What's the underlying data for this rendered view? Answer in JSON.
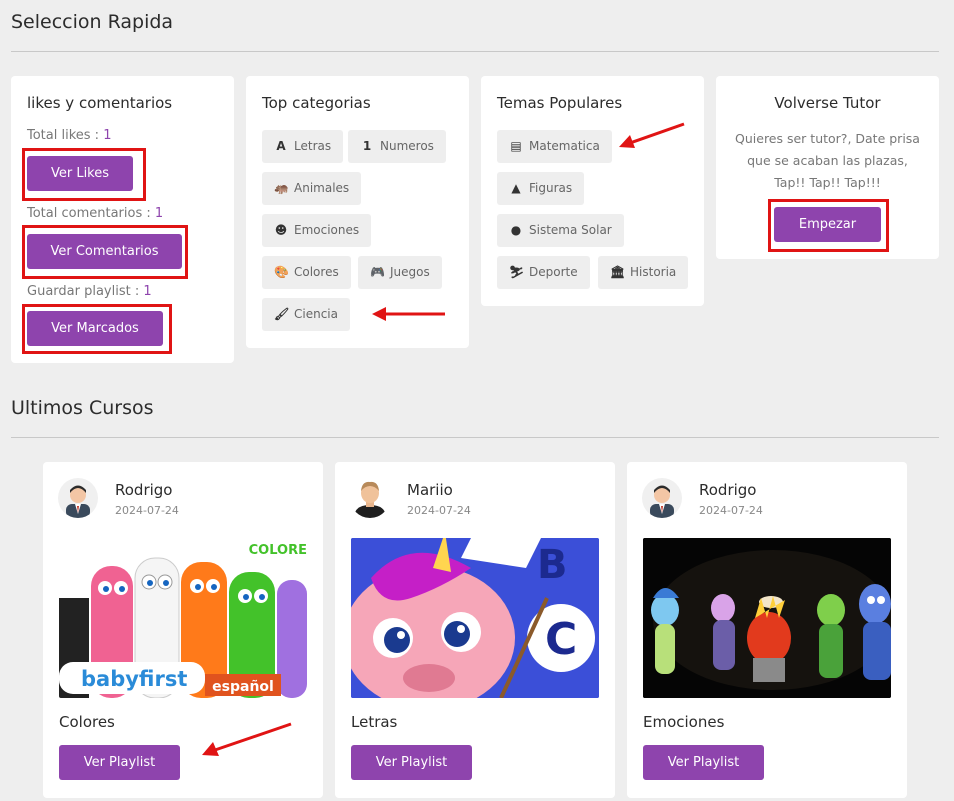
{
  "quick": {
    "title": "Seleccion Rapida",
    "likes_card": {
      "title": "likes y comentarios",
      "likes_label": "Total likes : ",
      "likes_count": "1",
      "likes_button": "Ver Likes",
      "comments_label": "Total comentarios : ",
      "comments_count": "1",
      "comments_button": "Ver Comentarios",
      "playlist_label": "Guardar playlist : ",
      "playlist_count": "1",
      "playlist_button": "Ver Marcados"
    },
    "categories_card": {
      "title": "Top categorias",
      "tags": [
        {
          "label": "Letras",
          "icon": "letter-a-icon"
        },
        {
          "label": "Numeros",
          "icon": "number-one-icon"
        },
        {
          "label": "Animales",
          "icon": "hippo-icon"
        },
        {
          "label": "Emociones",
          "icon": "smiley-icon"
        },
        {
          "label": "Colores",
          "icon": "palette-icon"
        },
        {
          "label": "Juegos",
          "icon": "gamepad-icon"
        },
        {
          "label": "Ciencia",
          "icon": "brush-icon"
        }
      ]
    },
    "topics_card": {
      "title": "Temas Populares",
      "tags": [
        {
          "label": "Matematica",
          "icon": "calculator-icon"
        },
        {
          "label": "Figuras",
          "icon": "shapes-icon"
        },
        {
          "label": "Sistema Solar",
          "icon": "globe-icon"
        },
        {
          "label": "Deporte",
          "icon": "skier-icon"
        },
        {
          "label": "Historia",
          "icon": "museum-icon"
        }
      ]
    },
    "tutor_card": {
      "title": "Volverse Tutor",
      "text_line1": "Quieres ser tutor?, Date prisa",
      "text_line2": "que se acaban las plazas,",
      "text_line3": "Tap!! Tap!! Tap!!!",
      "button": "Empezar"
    }
  },
  "courses": {
    "title": "Ultimos Cursos",
    "items": [
      {
        "author": "Rodrigo",
        "date": "2024-07-24",
        "title": "Colores",
        "button": "Ver Playlist",
        "thumb_text_1": "COLORE",
        "thumb_text_2": "babyfirst",
        "thumb_text_3": "español"
      },
      {
        "author": "Mariio",
        "date": "2024-07-24",
        "title": "Letras",
        "button": "Ver Playlist",
        "thumb_text_1": "B",
        "thumb_text_2": "C"
      },
      {
        "author": "Rodrigo",
        "date": "2024-07-24",
        "title": "Emociones",
        "button": "Ver Playlist"
      }
    ]
  },
  "colors": {
    "accent": "#8e44ad",
    "annotation_red": "#e01414",
    "page_bg": "#eeeeee"
  }
}
